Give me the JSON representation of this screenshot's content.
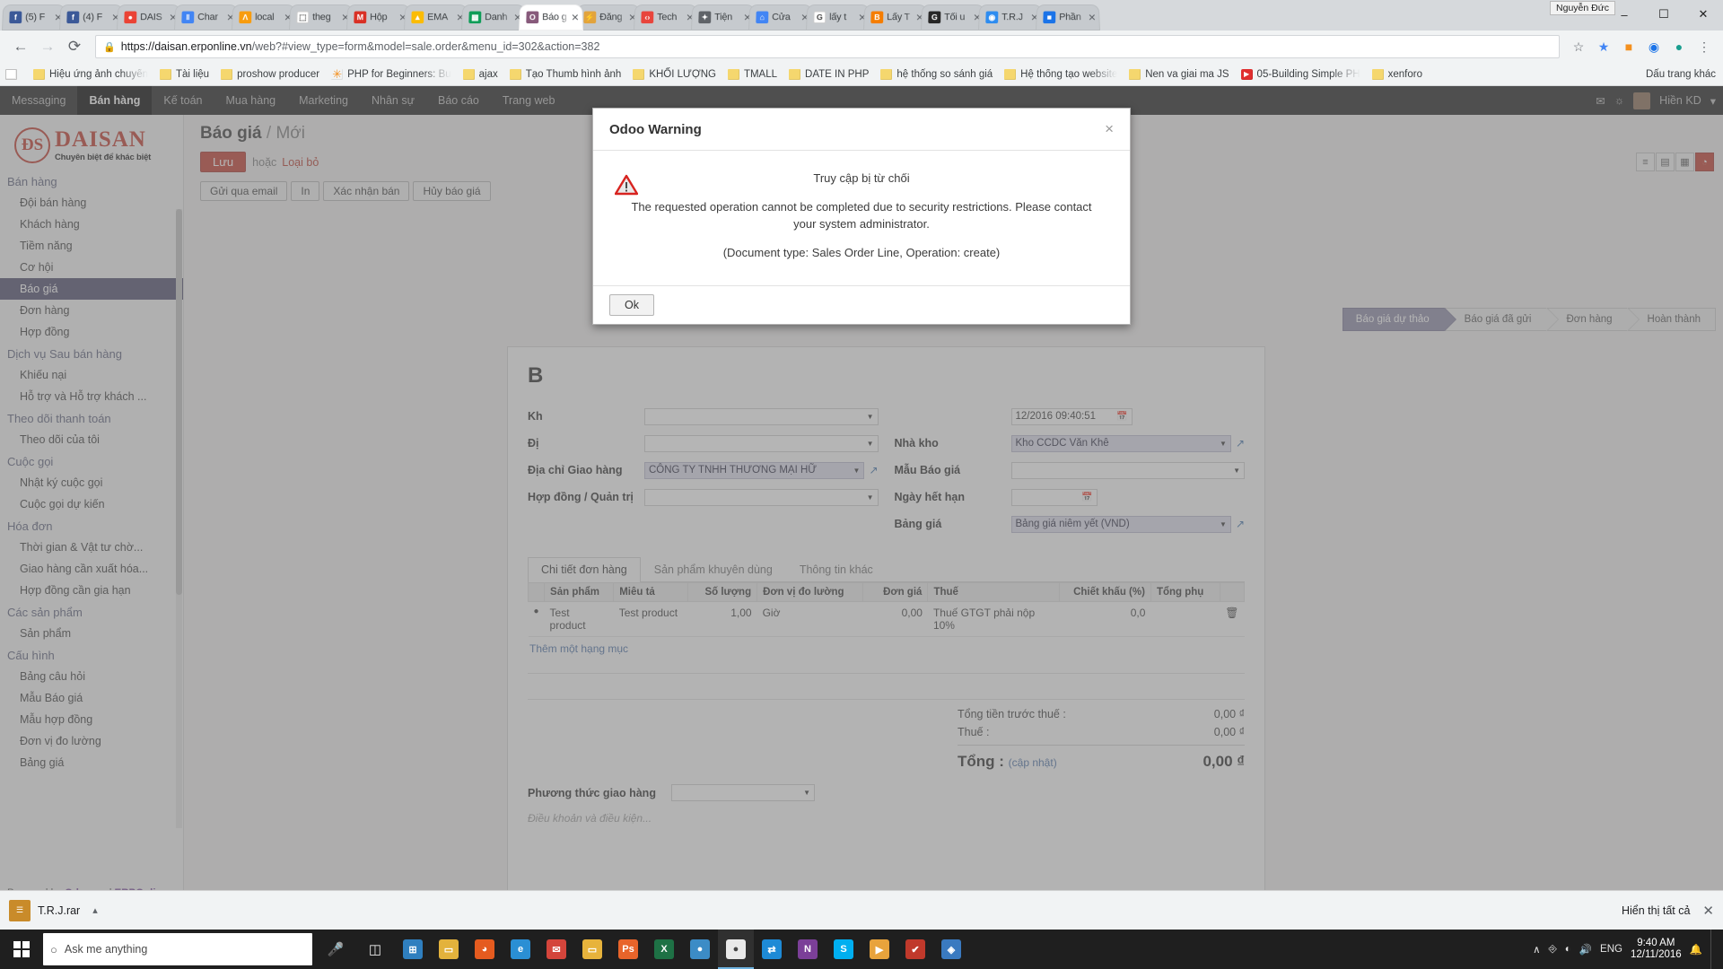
{
  "browser": {
    "tabs": [
      {
        "label": "(5) F",
        "favicon": "facebook-icon",
        "color": "#3b5998",
        "glyph": "f",
        "active": false
      },
      {
        "label": "(4) F",
        "favicon": "facebook-icon",
        "color": "#3b5998",
        "glyph": "f",
        "active": false
      },
      {
        "label": "DAIS",
        "favicon": "chrome-icon",
        "color": "#ea4335",
        "glyph": "●",
        "active": false
      },
      {
        "label": "Char",
        "favicon": "chart-icon",
        "color": "#4285f4",
        "glyph": "‖",
        "active": false
      },
      {
        "label": "local",
        "favicon": "phpmyadmin-icon",
        "color": "#f89c0e",
        "glyph": "Λ",
        "active": false
      },
      {
        "label": "theg",
        "favicon": "page-icon",
        "color": "#ffffff",
        "glyph": "⬚",
        "active": false
      },
      {
        "label": "Hộp",
        "favicon": "gmail-icon",
        "color": "#d93025",
        "glyph": "M",
        "active": false
      },
      {
        "label": "EMA",
        "favicon": "drive-icon",
        "color": "#fbbc04",
        "glyph": "▲",
        "active": false
      },
      {
        "label": "Danh",
        "favicon": "sheets-icon",
        "color": "#0f9d58",
        "glyph": "▦",
        "active": false
      },
      {
        "label": "Báo g",
        "favicon": "odoo-icon",
        "color": "#875a7b",
        "glyph": "O",
        "active": true
      },
      {
        "label": "Đăng",
        "favicon": "shield-icon",
        "color": "#e2a33c",
        "glyph": "⚡",
        "active": false
      },
      {
        "label": "Tech",
        "favicon": "code-icon",
        "color": "#e8453c",
        "glyph": "‹›",
        "active": false
      },
      {
        "label": "Tiện",
        "favicon": "puzzle-icon",
        "color": "#5f6368",
        "glyph": "✦",
        "active": false
      },
      {
        "label": "Cửa",
        "favicon": "store-icon",
        "color": "#4285f4",
        "glyph": "⌂",
        "active": false
      },
      {
        "label": "lấy t",
        "favicon": "google-icon",
        "color": "#ffffff",
        "glyph": "G",
        "active": false
      },
      {
        "label": "Lấy T",
        "favicon": "blogger-icon",
        "color": "#f57d00",
        "glyph": "B",
        "active": false
      },
      {
        "label": "Tối u",
        "favicon": "g-dark-icon",
        "color": "#262626",
        "glyph": "G",
        "active": false
      },
      {
        "label": "T.R.J",
        "favicon": "link-icon",
        "color": "#2d8cf0",
        "glyph": "◉",
        "active": false
      },
      {
        "label": "Phần",
        "favicon": "blue-icon",
        "color": "#1a73e8",
        "glyph": "■",
        "active": false
      }
    ],
    "window_user": "Nguyễn Đức",
    "window_buttons": {
      "minimize": "–",
      "maximize": "☐",
      "close": "✕"
    },
    "nav": {
      "back": "←",
      "forward": "→",
      "reload": "⟳"
    },
    "url": {
      "lock": "🔒",
      "host": "https://daisan.erponline.vn",
      "rest": "/web?#view_type=form&model=sale.order&menu_id=302&action=382"
    },
    "omni_icons": [
      "bookmark-star-icon",
      "extension-orange-icon",
      "extension-blue-icon",
      "extension-teal-icon",
      "menu-icon"
    ],
    "bookmarks": [
      {
        "label": "",
        "icon": "doc"
      },
      {
        "label": "Hiệu ứng ảnh chuyển",
        "icon": "folder",
        "fade": true
      },
      {
        "label": "Tài liệu",
        "icon": "folder"
      },
      {
        "label": "proshow producer",
        "icon": "folder"
      },
      {
        "label": "PHP for Beginners: Bu",
        "icon": "star",
        "fade": true
      },
      {
        "label": "ajax",
        "icon": "folder"
      },
      {
        "label": "Tạo Thumb hình ảnh",
        "icon": "folder"
      },
      {
        "label": "KHỐI LƯỢNG",
        "icon": "folder"
      },
      {
        "label": "TMALL",
        "icon": "folder"
      },
      {
        "label": "DATE IN PHP",
        "icon": "folder"
      },
      {
        "label": "hệ thống so sánh giá",
        "icon": "folder"
      },
      {
        "label": "Hệ thống tạo website",
        "icon": "folder",
        "fade": true
      },
      {
        "label": "Nen va giai ma JS",
        "icon": "folder"
      },
      {
        "label": "05-Building Simple PH",
        "icon": "yt",
        "fade": true
      },
      {
        "label": "xenforo",
        "icon": "folder"
      }
    ],
    "bookmarks_overflow": "Dấu trang khác",
    "bookmarks_overflow_icon": "folder"
  },
  "odoo": {
    "topmenu": [
      {
        "label": "Messaging",
        "active": false
      },
      {
        "label": "Bán hàng",
        "active": true
      },
      {
        "label": "Kế toán",
        "active": false
      },
      {
        "label": "Mua hàng",
        "active": false
      },
      {
        "label": "Marketing",
        "active": false
      },
      {
        "label": "Nhân sự",
        "active": false
      },
      {
        "label": "Báo cáo",
        "active": false
      },
      {
        "label": "Trang web",
        "active": false
      }
    ],
    "topright": {
      "mail_icon": "envelope-icon",
      "bell_icon": "bell-icon",
      "user": "Hiền KD",
      "caret": "▾"
    },
    "brand": {
      "name": "DAISAN",
      "mark": "ĐS",
      "tagline": "Chuyên biệt để khác biệt"
    },
    "sidebar": [
      {
        "label": "Bán hàng",
        "type": "group"
      },
      {
        "label": "Đội bán hàng",
        "type": "item"
      },
      {
        "label": "Khách hàng",
        "type": "item"
      },
      {
        "label": "Tiềm năng",
        "type": "item"
      },
      {
        "label": "Cơ hội",
        "type": "item"
      },
      {
        "label": "Báo giá",
        "type": "item",
        "selected": true
      },
      {
        "label": "Đơn hàng",
        "type": "item"
      },
      {
        "label": "Hợp đồng",
        "type": "item"
      },
      {
        "label": "Dịch vụ Sau bán hàng",
        "type": "group"
      },
      {
        "label": "Khiếu nại",
        "type": "item"
      },
      {
        "label": "Hỗ trợ và Hỗ trợ khách ...",
        "type": "item"
      },
      {
        "label": "Theo dõi thanh toán",
        "type": "group"
      },
      {
        "label": "Theo dõi của tôi",
        "type": "item"
      },
      {
        "label": "Cuộc gọi",
        "type": "group"
      },
      {
        "label": "Nhật ký cuộc gọi",
        "type": "item"
      },
      {
        "label": "Cuộc gọi dự kiến",
        "type": "item"
      },
      {
        "label": "Hóa đơn",
        "type": "group"
      },
      {
        "label": "Thời gian & Vật tư chờ...",
        "type": "item"
      },
      {
        "label": "Giao hàng cần xuất hóa...",
        "type": "item"
      },
      {
        "label": "Hợp đồng cần gia hạn",
        "type": "item"
      },
      {
        "label": "Các sản phẩm",
        "type": "group"
      },
      {
        "label": "Sản phẩm",
        "type": "item"
      },
      {
        "label": "Cấu hình",
        "type": "group"
      },
      {
        "label": "Bảng câu hỏi",
        "type": "item"
      },
      {
        "label": "Mẫu Báo giá",
        "type": "item"
      },
      {
        "label": "Mẫu hợp đồng",
        "type": "item"
      },
      {
        "label": "Đơn vị đo lường",
        "type": "item"
      },
      {
        "label": "Bảng giá",
        "type": "item"
      }
    ],
    "sidebar_footer": {
      "prefix": "Powered by ",
      "odoo": "Odoo",
      "mid": " and ",
      "erp": "ERPOnline"
    },
    "breadcrumb": {
      "main": "Báo giá",
      "sep": "/",
      "sub": "Mới"
    },
    "save_row": {
      "save": "Lưu",
      "or": "hoặc",
      "discard": "Loại bỏ"
    },
    "toolbar": [
      "Gửi qua email",
      "In",
      "Xác nhận bán",
      "Hủy báo giá"
    ],
    "view_switch": [
      {
        "icon": "list-icon",
        "glyph": "≡",
        "active": false
      },
      {
        "icon": "form-icon",
        "glyph": "▤",
        "active": false
      },
      {
        "icon": "calendar-icon",
        "glyph": "▦",
        "active": false
      },
      {
        "icon": "graph-icon",
        "glyph": "◔",
        "active": true
      }
    ],
    "status": [
      {
        "label": "Báo giá dự thảo",
        "active": true
      },
      {
        "label": "Báo giá đã gửi",
        "active": false
      },
      {
        "label": "Đơn hàng",
        "active": false
      },
      {
        "label": "Hoàn thành",
        "active": false
      }
    ],
    "form": {
      "title": "B",
      "left": [
        {
          "label": "Kh",
          "value": "",
          "type": "select"
        },
        {
          "label": "Đị",
          "value": "",
          "type": "select"
        },
        {
          "label": "Địa chỉ Giao hàng",
          "value": "CÔNG TY TNHH THƯƠNG MẠI HỮ",
          "type": "select",
          "ext": true
        },
        {
          "label": "Hợp đồng / Quản trị",
          "value": "",
          "type": "select-empty"
        }
      ],
      "right": [
        {
          "label": "",
          "value": "12/2016 09:40:51",
          "type": "date"
        },
        {
          "label": "Nhà kho",
          "value": "Kho CCDC Văn Khê",
          "type": "select",
          "ext": true
        },
        {
          "label": "Mẫu Báo giá",
          "value": "",
          "type": "select-empty"
        },
        {
          "label": "Ngày hết hạn",
          "value": "",
          "type": "date-empty"
        },
        {
          "label": "Bảng giá",
          "value": "Bảng giá niêm yết (VND)",
          "type": "select",
          "ext": true
        }
      ]
    },
    "notebook_tabs": [
      {
        "label": "Chi tiết đơn hàng",
        "active": true
      },
      {
        "label": "Sản phẩm khuyên dùng",
        "active": false
      },
      {
        "label": "Thông tin khác",
        "active": false
      }
    ],
    "lines_table": {
      "columns": [
        "",
        "Sản phẩm",
        "Miêu tả",
        "Số lượng",
        "Đơn vị đo lường",
        "Đơn giá",
        "Thuế",
        "Chiết khấu (%)",
        "Tổng phụ",
        ""
      ],
      "rows": [
        {
          "product": "Test product",
          "description": "Test product",
          "qty": "1,00",
          "uom": "Giờ",
          "price": "0,00",
          "tax": "Thuế GTGT phải nộp 10%",
          "discount": "0,0",
          "subtotal": "",
          "delete_icon": "trash-icon"
        }
      ],
      "add_link": "Thêm một hạng mục"
    },
    "totals": [
      {
        "label": "Tổng tiền trước thuế :",
        "value": "0,00 ₫"
      },
      {
        "label": "Thuế :",
        "value": "0,00 ₫"
      }
    ],
    "grand_total": {
      "label": "Tổng :",
      "update": "(cập nhật)",
      "value": "0,00 ₫"
    },
    "shipping": {
      "label": "Phương thức giao hàng",
      "value": ""
    },
    "terms_placeholder": "Điều khoản và điều kiện..."
  },
  "modal": {
    "title": "Odoo Warning",
    "close": "×",
    "icon": "warning-triangle-icon",
    "line1": "Truy cập bị từ chối",
    "line2": "The requested operation cannot be completed due to security restrictions. Please contact your system administrator.",
    "line3": "(Document type: Sales Order Line, Operation: create)",
    "ok": "Ok"
  },
  "downloads": {
    "file": "T.R.J.rar",
    "icon": "archive-icon",
    "caret": "▴",
    "show_all": "Hiển thị tất cả",
    "close": "✕"
  },
  "taskbar": {
    "search_placeholder": "Ask me anything",
    "search_icon": "search-icon",
    "cortana_icon": "microphone-icon",
    "taskview_icon": "task-view-icon",
    "apps": [
      {
        "name": "store-icon",
        "color": "#2f7fbf",
        "glyph": "⊞"
      },
      {
        "name": "folder-icon",
        "color": "#e3b23c",
        "glyph": "▭"
      },
      {
        "name": "firefox-icon",
        "color": "#e55b1f",
        "glyph": "◕"
      },
      {
        "name": "edge-icon",
        "color": "#2a8fd4",
        "glyph": "e"
      },
      {
        "name": "mail-icon",
        "color": "#d4453b",
        "glyph": "✉"
      },
      {
        "name": "explorer-icon",
        "color": "#e7b33c",
        "glyph": "▭"
      },
      {
        "name": "photoshop-icon",
        "color": "#e8642a",
        "glyph": "Ps"
      },
      {
        "name": "excel-icon",
        "color": "#1e7145",
        "glyph": "X"
      },
      {
        "name": "vpn-icon",
        "color": "#3c8cc6",
        "glyph": "●"
      },
      {
        "name": "chrome-icon",
        "color": "#e9e9e9",
        "glyph": "●",
        "active": true
      },
      {
        "name": "teamviewer-icon",
        "color": "#1e8ad6",
        "glyph": "⇄"
      },
      {
        "name": "onenote-icon",
        "color": "#7b3f98",
        "glyph": "N"
      },
      {
        "name": "skype-icon",
        "color": "#00aff0",
        "glyph": "S"
      },
      {
        "name": "media-player-icon",
        "color": "#e8a33c",
        "glyph": "▶"
      },
      {
        "name": "antivirus-icon",
        "color": "#c0392b",
        "glyph": "✔"
      },
      {
        "name": "unikey-icon",
        "color": "#3a7ac0",
        "glyph": "◈"
      }
    ],
    "tray": {
      "caret": "∧",
      "icons": [
        "usb-icon",
        "network-icon",
        "volume-icon"
      ],
      "lang": "ENG",
      "time": "9:40 AM",
      "date": "12/11/2016",
      "notification_icon": "notification-icon"
    }
  }
}
